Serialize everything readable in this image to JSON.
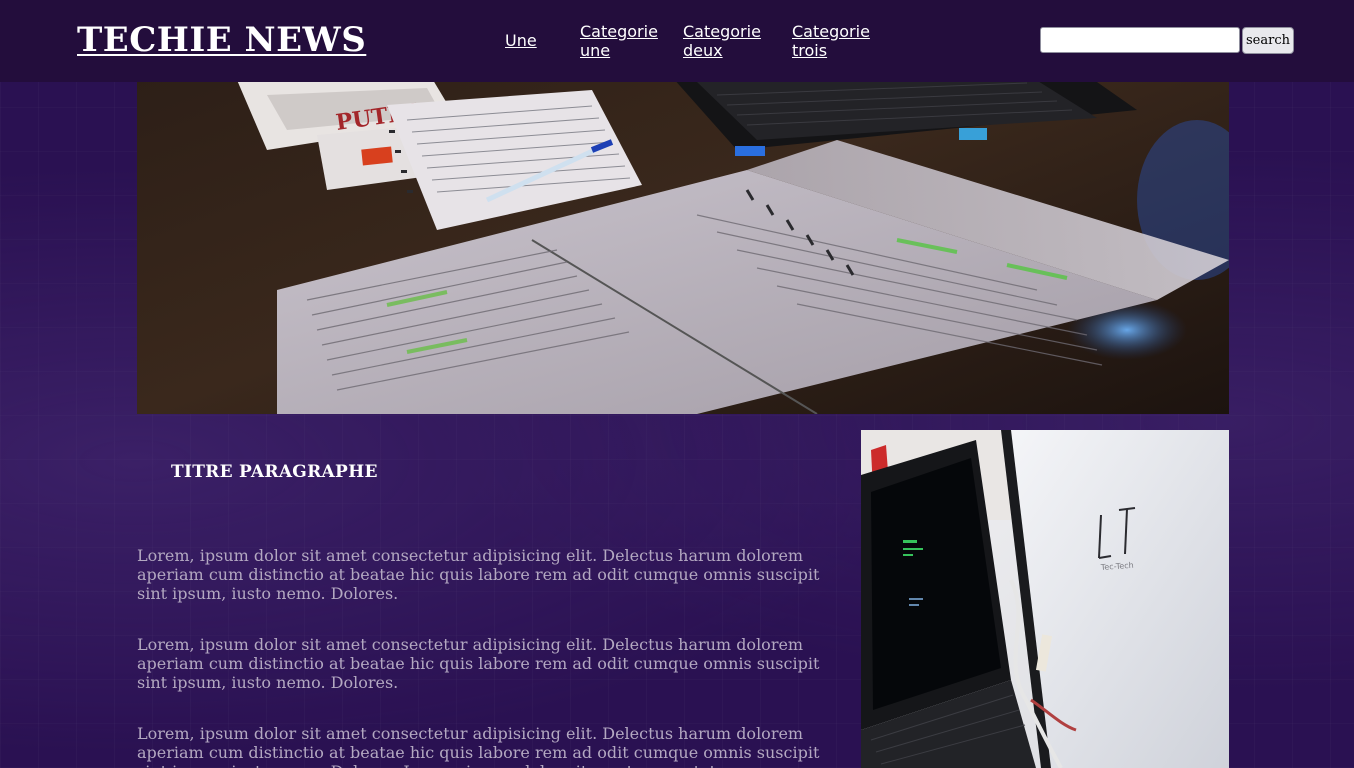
{
  "header": {
    "logo": "TECHIE NEWS",
    "nav": [
      {
        "label": "Une"
      },
      {
        "label": "Categorie une"
      },
      {
        "label": "Categorie deux"
      },
      {
        "label": "Categorie trois"
      }
    ],
    "search": {
      "value": "",
      "placeholder": "",
      "button_label": "search"
    }
  },
  "hero": {
    "book_cover_text": "PUTIN"
  },
  "main": {
    "title": "TITRE PARAGRAPHE",
    "paragraphs": [
      "Lorem, ipsum dolor sit amet consectetur adipisicing elit. Delectus harum dolorem aperiam cum distinctio at beatae hic quis labore rem ad odit cumque omnis suscipit sint ipsum, iusto nemo. Dolores.",
      "Lorem, ipsum dolor sit amet consectetur adipisicing elit. Delectus harum dolorem aperiam cum distinctio at beatae hic quis labore rem ad odit cumque omnis suscipit sint ipsum, iusto nemo. Dolores.",
      "Lorem, ipsum dolor sit amet consectetur adipisicing elit. Delectus harum dolorem aperiam cum distinctio at beatae hic quis labore rem ad odit cumque omnis suscipit sint ipsum, iusto nemo. Dolores. Lorem, ipsum dolor sit amet consectetur"
    ]
  },
  "colors": {
    "page_background": "#2a1152",
    "header_background": "#230d3c",
    "logo_text": "#ffffff",
    "paragraph_text": "#b3a8c1"
  }
}
